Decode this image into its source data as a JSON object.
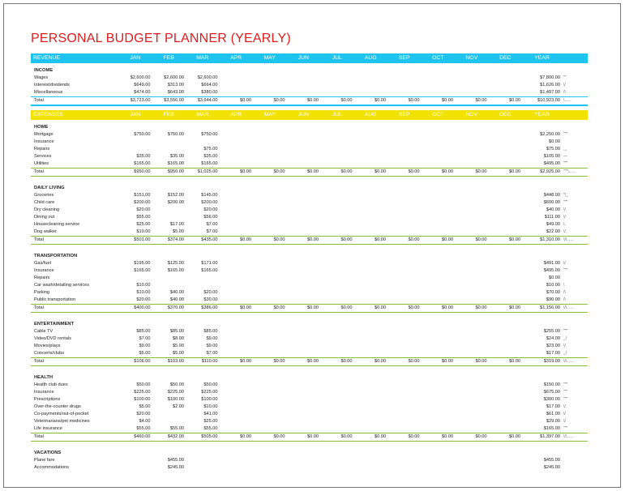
{
  "title": "PERSONAL BUDGET PLANNER (YEARLY)",
  "months": [
    "JAN",
    "FEB",
    "MAR",
    "APR",
    "MAY",
    "JUN",
    "JUL",
    "AUG",
    "SEP",
    "OCT",
    "NOV",
    "DEC"
  ],
  "year_label": "YEAR",
  "revenue": {
    "header": "REVENUE",
    "section": "INCOME",
    "rows": [
      {
        "label": "Wages",
        "values": [
          "$2,600.00",
          "$2,600.00",
          "$2,600.00",
          "",
          "",
          "",
          "",
          "",
          "",
          "",
          "",
          ""
        ],
        "year": "$7,800.00",
        "spark": "\"\""
      },
      {
        "label": "Interest/dividends",
        "values": [
          "$649.00",
          "$313.00",
          "$664.00",
          "",
          "",
          "",
          "",
          "",
          "",
          "",
          "",
          ""
        ],
        "year": "$1,626.00",
        "spark": "\\/"
      },
      {
        "label": "Miscellaneous",
        "values": [
          "$474.00",
          "$643.00",
          "$380.00",
          "",
          "",
          "",
          "",
          "",
          "",
          "",
          "",
          ""
        ],
        "year": "$1,497.00",
        "spark": "/\\"
      }
    ],
    "total": {
      "label": "Total",
      "values": [
        "$3,723.00",
        "$3,556.00",
        "$3,644.00",
        "$0.00",
        "$0.00",
        "$0.00",
        "$0.00",
        "$0.00",
        "$0.00",
        "$0.00",
        "$0.00",
        "$0.00"
      ],
      "year": "$10,923.00",
      "spark": "\\......"
    }
  },
  "expenses": {
    "header": "EXPENSES",
    "groups": [
      {
        "section": "HOME",
        "rows": [
          {
            "label": "Mortgage",
            "values": [
              "$750.00",
              "$750.00",
              "$750.00",
              "",
              "",
              "",
              "",
              "",
              "",
              "",
              "",
              ""
            ],
            "year": "$2,250.00",
            "spark": "\"\"\""
          },
          {
            "label": "Insurance",
            "values": [
              "",
              "",
              "",
              "",
              "",
              "",
              "",
              "",
              "",
              "",
              "",
              ""
            ],
            "year": "$0.00",
            "spark": ""
          },
          {
            "label": "Repairs",
            "values": [
              "",
              "",
              "$75.00",
              "",
              "",
              "",
              "",
              "",
              "",
              "",
              "",
              ""
            ],
            "year": "$75.00",
            "spark": "_,"
          },
          {
            "label": "Services",
            "values": [
              "$35.00",
              "$35.00",
              "$35.00",
              "",
              "",
              "",
              "",
              "",
              "",
              "",
              "",
              ""
            ],
            "year": "$105.00",
            "spark": "—"
          },
          {
            "label": "Utilities",
            "values": [
              "$165.00",
              "$165.00",
              "$165.00",
              "",
              "",
              "",
              "",
              "",
              "",
              "",
              "",
              ""
            ],
            "year": "$495.00",
            "spark": "\"\"\""
          }
        ],
        "total": {
          "label": "Total",
          "values": [
            "$950.00",
            "$950.00",
            "$1,025.00",
            "$0.00",
            "$0.00",
            "$0.00",
            "$0.00",
            "$0.00",
            "$0.00",
            "$0.00",
            "$0.00",
            "$0.00"
          ],
          "year": "$2,925.00",
          "spark": "\"\"\"\\......"
        }
      },
      {
        "section": "DAILY LIVING",
        "rows": [
          {
            "label": "Groceries",
            "values": [
              "$151.00",
              "$152.00",
              "$145.00",
              "",
              "",
              "",
              "",
              "",
              "",
              "",
              "",
              ""
            ],
            "year": "$448.00",
            "spark": "\"\\_"
          },
          {
            "label": "Child care",
            "values": [
              "$200.00",
              "$200.00",
              "$200.00",
              "",
              "",
              "",
              "",
              "",
              "",
              "",
              "",
              ""
            ],
            "year": "$600.00",
            "spark": "\"\"\""
          },
          {
            "label": "Dry cleaning",
            "values": [
              "$20.00",
              "",
              "$20.00",
              "",
              "",
              "",
              "",
              "",
              "",
              "",
              "",
              ""
            ],
            "year": "$40.00",
            "spark": "\\/"
          },
          {
            "label": "Dining out",
            "values": [
              "$55.00",
              "",
              "$56.00",
              "",
              "",
              "",
              "",
              "",
              "",
              "",
              "",
              ""
            ],
            "year": "$111.00",
            "spark": "\\/"
          },
          {
            "label": "Housecleaning service",
            "values": [
              "$25.00",
              "$17.00",
              "$7.00",
              "",
              "",
              "",
              "",
              "",
              "",
              "",
              "",
              ""
            ],
            "year": "$49.00",
            "spark": "\\."
          },
          {
            "label": "Dog walker",
            "values": [
              "$10.00",
              "$5.00",
              "$7.00",
              "",
              "",
              "",
              "",
              "",
              "",
              "",
              "",
              ""
            ],
            "year": "$22.00",
            "spark": "\\/"
          }
        ],
        "total": {
          "label": "Total",
          "values": [
            "$501.00",
            "$374.00",
            "$435.00",
            "$0.00",
            "$0.00",
            "$0.00",
            "$0.00",
            "$0.00",
            "$0.00",
            "$0.00",
            "$0.00",
            "$0.00"
          ],
          "year": "$1,310.00",
          "spark": "\\/\\......"
        }
      },
      {
        "section": "TRANSPORTATION",
        "rows": [
          {
            "label": "Gas/fuel",
            "values": [
              "$195.00",
              "$125.00",
              "$171.00",
              "",
              "",
              "",
              "",
              "",
              "",
              "",
              "",
              ""
            ],
            "year": "$491.00",
            "spark": "\\/"
          },
          {
            "label": "Insurance",
            "values": [
              "$165.00",
              "$165.00",
              "$165.00",
              "",
              "",
              "",
              "",
              "",
              "",
              "",
              "",
              ""
            ],
            "year": "$495.00",
            "spark": "\"\"\""
          },
          {
            "label": "Repairs",
            "values": [
              "",
              "",
              "",
              "",
              "",
              "",
              "",
              "",
              "",
              "",
              "",
              ""
            ],
            "year": "$0.00",
            "spark": ""
          },
          {
            "label": "Car wash/detailing services",
            "values": [
              "$10.00",
              "",
              "",
              "",
              "",
              "",
              "",
              "",
              "",
              "",
              "",
              ""
            ],
            "year": "$10.00",
            "spark": "\\"
          },
          {
            "label": "Parking",
            "values": [
              "$10.00",
              "$40.00",
              "$20.00",
              "",
              "",
              "",
              "",
              "",
              "",
              "",
              "",
              ""
            ],
            "year": "$70.00",
            "spark": "/\\"
          },
          {
            "label": "Public transportation",
            "values": [
              "$20.00",
              "$40.00",
              "$30.00",
              "",
              "",
              "",
              "",
              "",
              "",
              "",
              "",
              ""
            ],
            "year": "$90.00",
            "spark": "/\\"
          }
        ],
        "total": {
          "label": "Total",
          "values": [
            "$400.00",
            "$370.00",
            "$386.00",
            "$0.00",
            "$0.00",
            "$0.00",
            "$0.00",
            "$0.00",
            "$0.00",
            "$0.00",
            "$0.00",
            "$0.00"
          ],
          "year": "$1,156.00",
          "spark": "\\/\\......"
        }
      },
      {
        "section": "ENTERTAINMENT",
        "rows": [
          {
            "label": "Cable TV",
            "values": [
              "$85.00",
              "$85.00",
              "$85.00",
              "",
              "",
              "",
              "",
              "",
              "",
              "",
              "",
              ""
            ],
            "year": "$255.00",
            "spark": "\"\"\""
          },
          {
            "label": "Video/DVD rentals",
            "values": [
              "$7.00",
              "$8.00",
              "$9.00",
              "",
              "",
              "",
              "",
              "",
              "",
              "",
              "",
              ""
            ],
            "year": "$24.00",
            "spark": "_/"
          },
          {
            "label": "Movies/plays",
            "values": [
              "$9.00",
              "$5.00",
              "$9.00",
              "",
              "",
              "",
              "",
              "",
              "",
              "",
              "",
              ""
            ],
            "year": "$23.00",
            "spark": "\\/"
          },
          {
            "label": "Concerts/clubs",
            "values": [
              "$5.00",
              "$5.00",
              "$7.00",
              "",
              "",
              "",
              "",
              "",
              "",
              "",
              "",
              ""
            ],
            "year": "$17.00",
            "spark": "_/"
          }
        ],
        "total": {
          "label": "Total",
          "values": [
            "$106.00",
            "$103.00",
            "$110.00",
            "$0.00",
            "$0.00",
            "$0.00",
            "$0.00",
            "$0.00",
            "$0.00",
            "$0.00",
            "$0.00",
            "$0.00"
          ],
          "year": "$319.00",
          "spark": "\\/\\......"
        }
      },
      {
        "section": "HEALTH",
        "rows": [
          {
            "label": "Health club dues",
            "values": [
              "$50.00",
              "$50.00",
              "$50.00",
              "",
              "",
              "",
              "",
              "",
              "",
              "",
              "",
              ""
            ],
            "year": "$150.00",
            "spark": "\"\"\""
          },
          {
            "label": "Insurance",
            "values": [
              "$225.00",
              "$225.00",
              "$225.00",
              "",
              "",
              "",
              "",
              "",
              "",
              "",
              "",
              ""
            ],
            "year": "$675.00",
            "spark": "\"\"\""
          },
          {
            "label": "Prescriptions",
            "values": [
              "$100.00",
              "$100.00",
              "$100.00",
              "",
              "",
              "",
              "",
              "",
              "",
              "",
              "",
              ""
            ],
            "year": "$300.00",
            "spark": "\"\"\""
          },
          {
            "label": "Over-the-counter drugs",
            "values": [
              "$5.00",
              "$2.00",
              "$10.00",
              "",
              "",
              "",
              "",
              "",
              "",
              "",
              "",
              ""
            ],
            "year": "$17.00",
            "spark": "\\/"
          },
          {
            "label": "Co-payments/out-of-pocket",
            "values": [
              "$20.00",
              "",
              "$41.00",
              "",
              "",
              "",
              "",
              "",
              "",
              "",
              "",
              ""
            ],
            "year": "$61.00",
            "spark": "\\/"
          },
          {
            "label": "Veterinarians/pet medicines",
            "values": [
              "$4.00",
              "",
              "$25.00",
              "",
              "",
              "",
              "",
              "",
              "",
              "",
              "",
              ""
            ],
            "year": "$29.00",
            "spark": "\\/"
          },
          {
            "label": "Life insurance",
            "values": [
              "$55.00",
              "$55.00",
              "$55.00",
              "",
              "",
              "",
              "",
              "",
              "",
              "",
              "",
              ""
            ],
            "year": "$165.00",
            "spark": "\"\"\""
          }
        ],
        "total": {
          "label": "Total",
          "values": [
            "$460.00",
            "$432.00",
            "$505.00",
            "$0.00",
            "$0.00",
            "$0.00",
            "$0.00",
            "$0.00",
            "$0.00",
            "$0.00",
            "$0.00",
            "$0.00"
          ],
          "year": "$1,397.00",
          "spark": "\\/\\......"
        }
      },
      {
        "section": "VACATIONS",
        "rows": [
          {
            "label": "Plane fare",
            "values": [
              "",
              "$455.00",
              "",
              "",
              "",
              "",
              "",
              "",
              "",
              "",
              "",
              ""
            ],
            "year": "$455.00",
            "spark": ""
          },
          {
            "label": "Accommodations",
            "values": [
              "",
              "$245.00",
              "",
              "",
              "",
              "",
              "",
              "",
              "",
              "",
              "",
              ""
            ],
            "year": "$245.00",
            "spark": ""
          }
        ]
      }
    ]
  }
}
